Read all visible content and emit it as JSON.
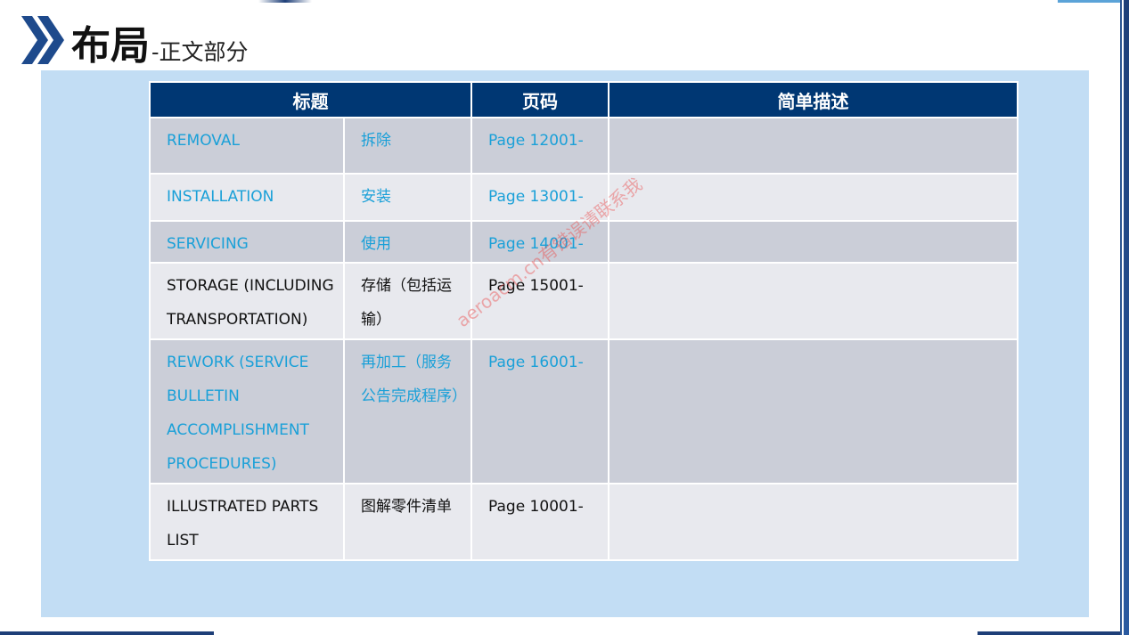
{
  "header": {
    "title_main": "布局",
    "title_sub": "-正文部分"
  },
  "table": {
    "headers": [
      "标题",
      "页码",
      "简单描述"
    ],
    "rows": [
      {
        "en": "REMOVAL",
        "zh": "拆除",
        "page": "Page 12001-",
        "desc": "",
        "style": "blue"
      },
      {
        "en": "INSTALLATION",
        "zh": "安装",
        "page": "Page 13001-",
        "desc": "",
        "style": "blue"
      },
      {
        "en": "SERVICING",
        "zh": "使用",
        "page": "Page 14001-",
        "desc": "",
        "style": "blue"
      },
      {
        "en": "STORAGE (INCLUDING TRANSPORTATION)",
        "zh": "存储（包括运输）",
        "page": "Page 15001-",
        "desc": "",
        "style": "black"
      },
      {
        "en": "REWORK (SERVICE BULLETIN ACCOMPLISHMENT PROCEDURES)",
        "zh": "再加工（服务公告完成程序）",
        "page": "Page 16001-",
        "desc": "",
        "style": "blue"
      },
      {
        "en": "ILLUSTRATED PARTS LIST",
        "zh": "图解零件清单",
        "page": "Page 10001-",
        "desc": "",
        "style": "black"
      }
    ]
  },
  "watermark": "aeroacm.cn有错误请联系我",
  "colors": {
    "header_bg": "#003773",
    "panel_bg": "#c2ddf4",
    "row_dark": "#cbced8",
    "row_light": "#e8e9ee",
    "link_blue": "#1aa0d8"
  },
  "icons": {
    "title_marker": "double-chevron-right-icon"
  }
}
